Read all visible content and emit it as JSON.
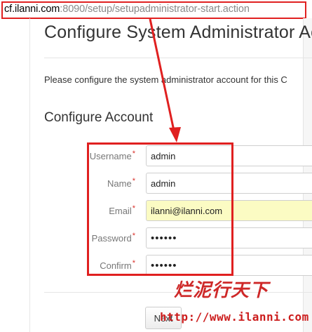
{
  "url_bar": {
    "host": "cf.ilanni.com",
    "path": ":8090/setup/setupadministrator-start.action"
  },
  "page": {
    "title": "Configure System Administrator Acc",
    "intro": "Please configure the system administrator account for this C",
    "section_title": "Configure Account"
  },
  "form": {
    "required_mark": "*",
    "fields": [
      {
        "label": "Username",
        "value": "admin"
      },
      {
        "label": "Name",
        "value": "admin"
      },
      {
        "label": "Email",
        "value": "ilanni@ilanni.com"
      },
      {
        "label": "Password",
        "value": "pppppp"
      },
      {
        "label": "Confirm",
        "value": "pppppp"
      }
    ]
  },
  "actions": {
    "next_label": "Next"
  },
  "watermark": {
    "logo_text": "烂泥行天下",
    "url_text": "http://www.ilanni.com"
  },
  "colors": {
    "annotation_red": "#e02020",
    "autofill_yellow": "#fbfbc3",
    "watermark_red": "#cc1d1d"
  }
}
